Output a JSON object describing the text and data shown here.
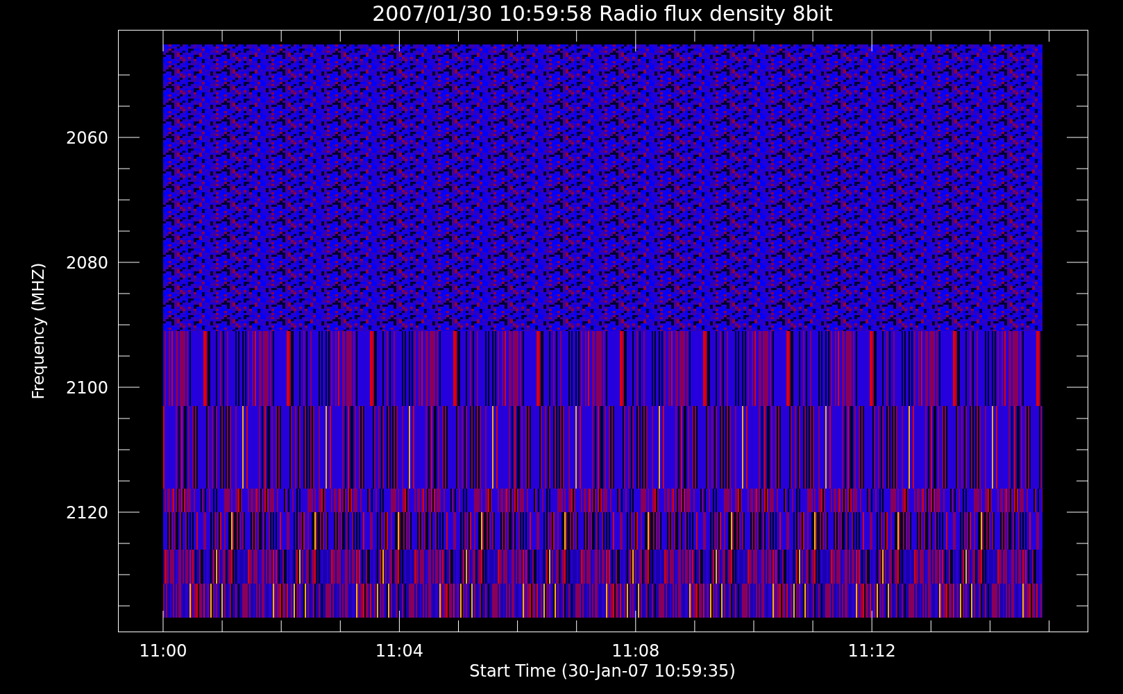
{
  "title": "2007/01/30 10:59:58 Radio flux density 8bit",
  "y_axis": {
    "label": "Frequency (MHZ)",
    "ticks": [
      "2060",
      "2080",
      "2100",
      "2120"
    ]
  },
  "x_axis": {
    "label": "Start Time (30-Jan-07 10:59:35)",
    "ticks": [
      "11:00",
      "11:04",
      "11:08",
      "11:12"
    ]
  }
}
